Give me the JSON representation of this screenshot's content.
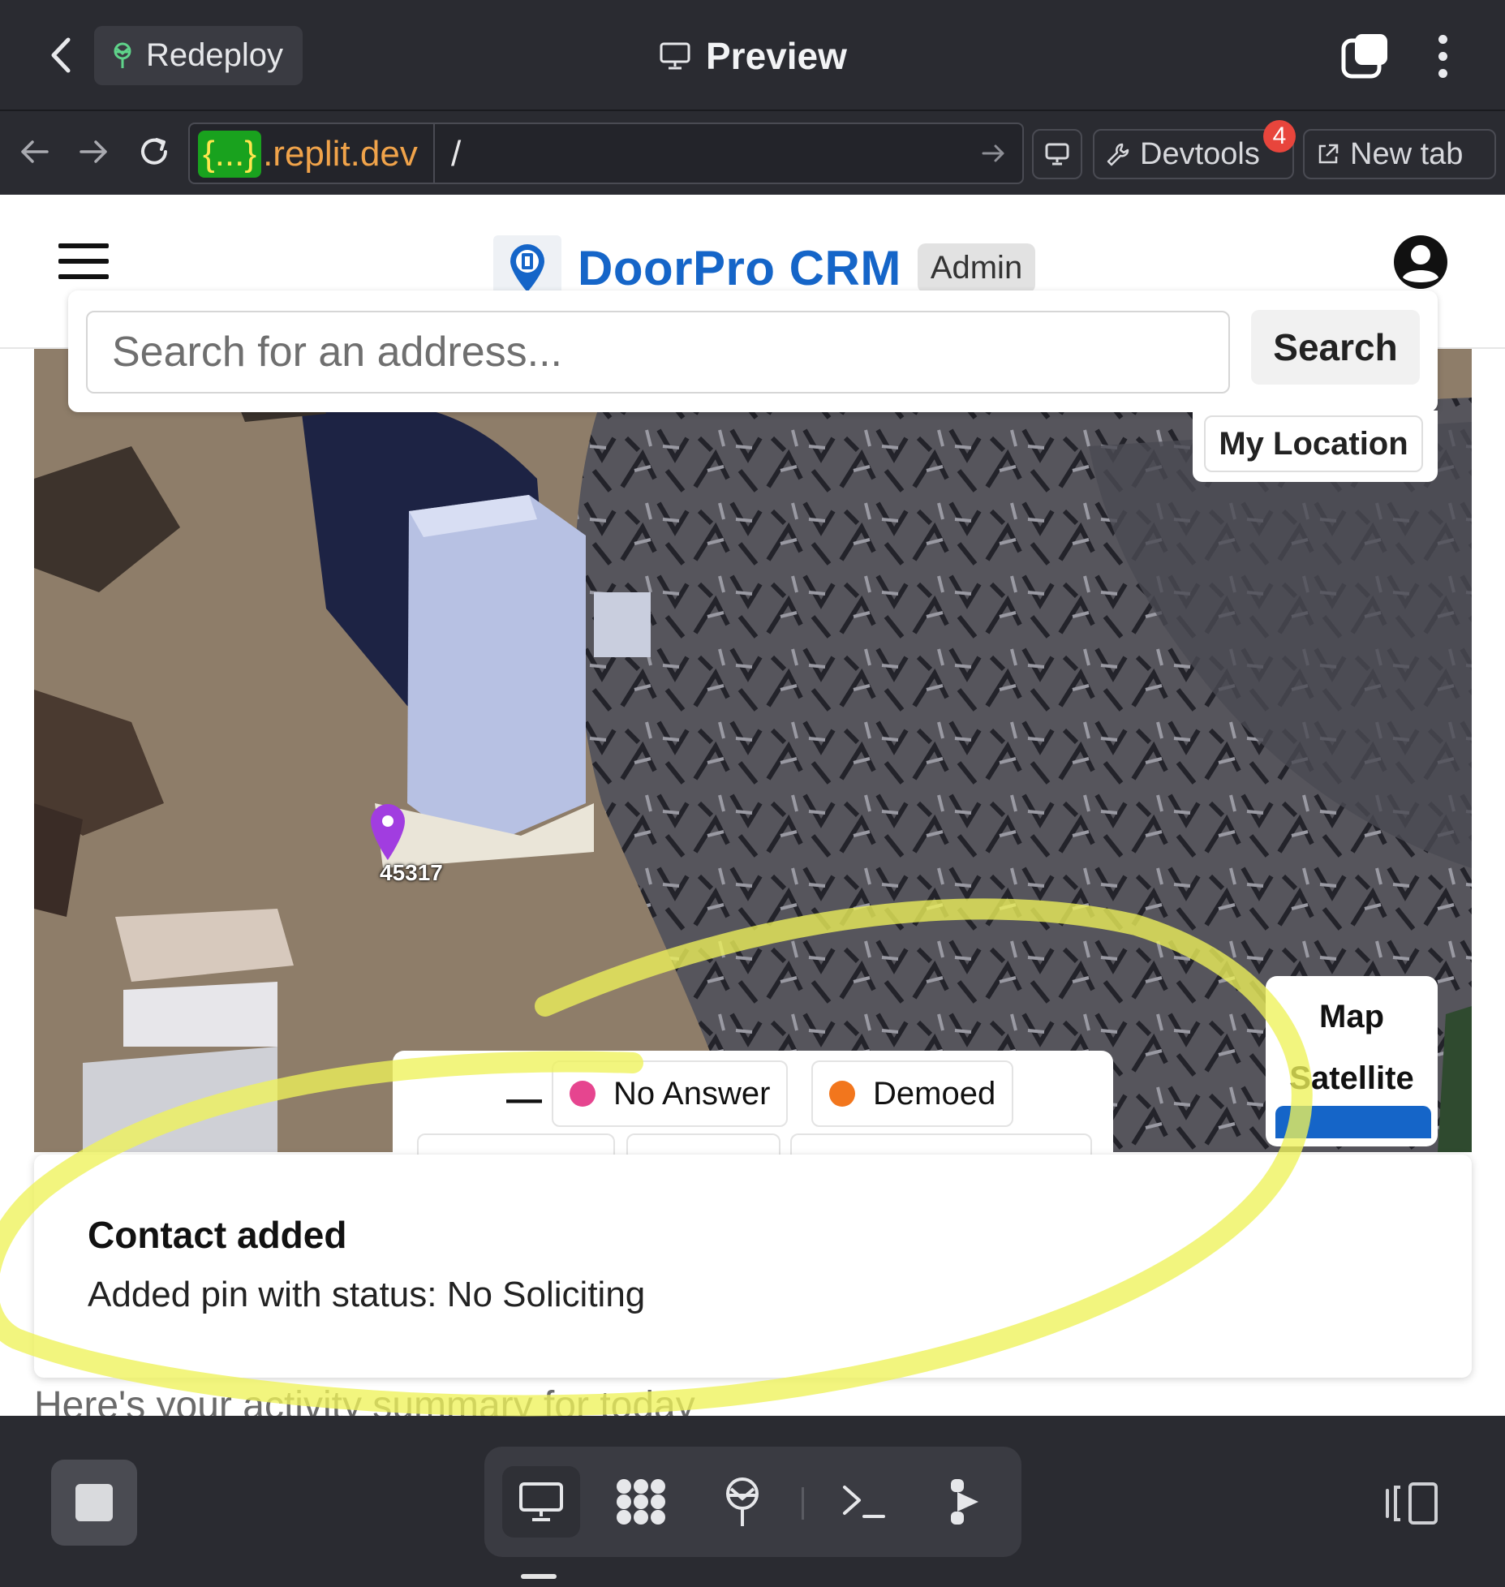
{
  "top_bar": {
    "redeploy_label": "Redeploy",
    "title": "Preview"
  },
  "url_bar": {
    "host_chip": "{...}",
    "host_domain": ".replit.dev",
    "path": "/",
    "devtools_label": "Devtools",
    "devtools_badge": "4",
    "new_tab_label": "New tab"
  },
  "app": {
    "brand_name": "DoorPro CRM",
    "role_chip": "Admin",
    "search": {
      "placeholder": "Search for an address...",
      "button_label": "Search"
    },
    "my_location_label": "My Location",
    "map": {
      "pin_label": "45317",
      "pin_color": "#a13de0",
      "map_type_options": [
        "Map",
        "Satellite"
      ]
    },
    "status_legend": {
      "collapse_label": "—",
      "items": [
        {
          "label": "No Answer",
          "color": "#e6458f"
        },
        {
          "label": "Demoed",
          "color": "#f2761d"
        }
      ]
    },
    "toast": {
      "title": "Contact added",
      "body": "Added pin with status: No Soliciting"
    },
    "subtitle": "Here's your activity summary for today"
  },
  "colors": {
    "brand_blue": "#1565c8",
    "chrome_bg": "#2a2b31",
    "annotation_yellow": "#eef25a"
  }
}
